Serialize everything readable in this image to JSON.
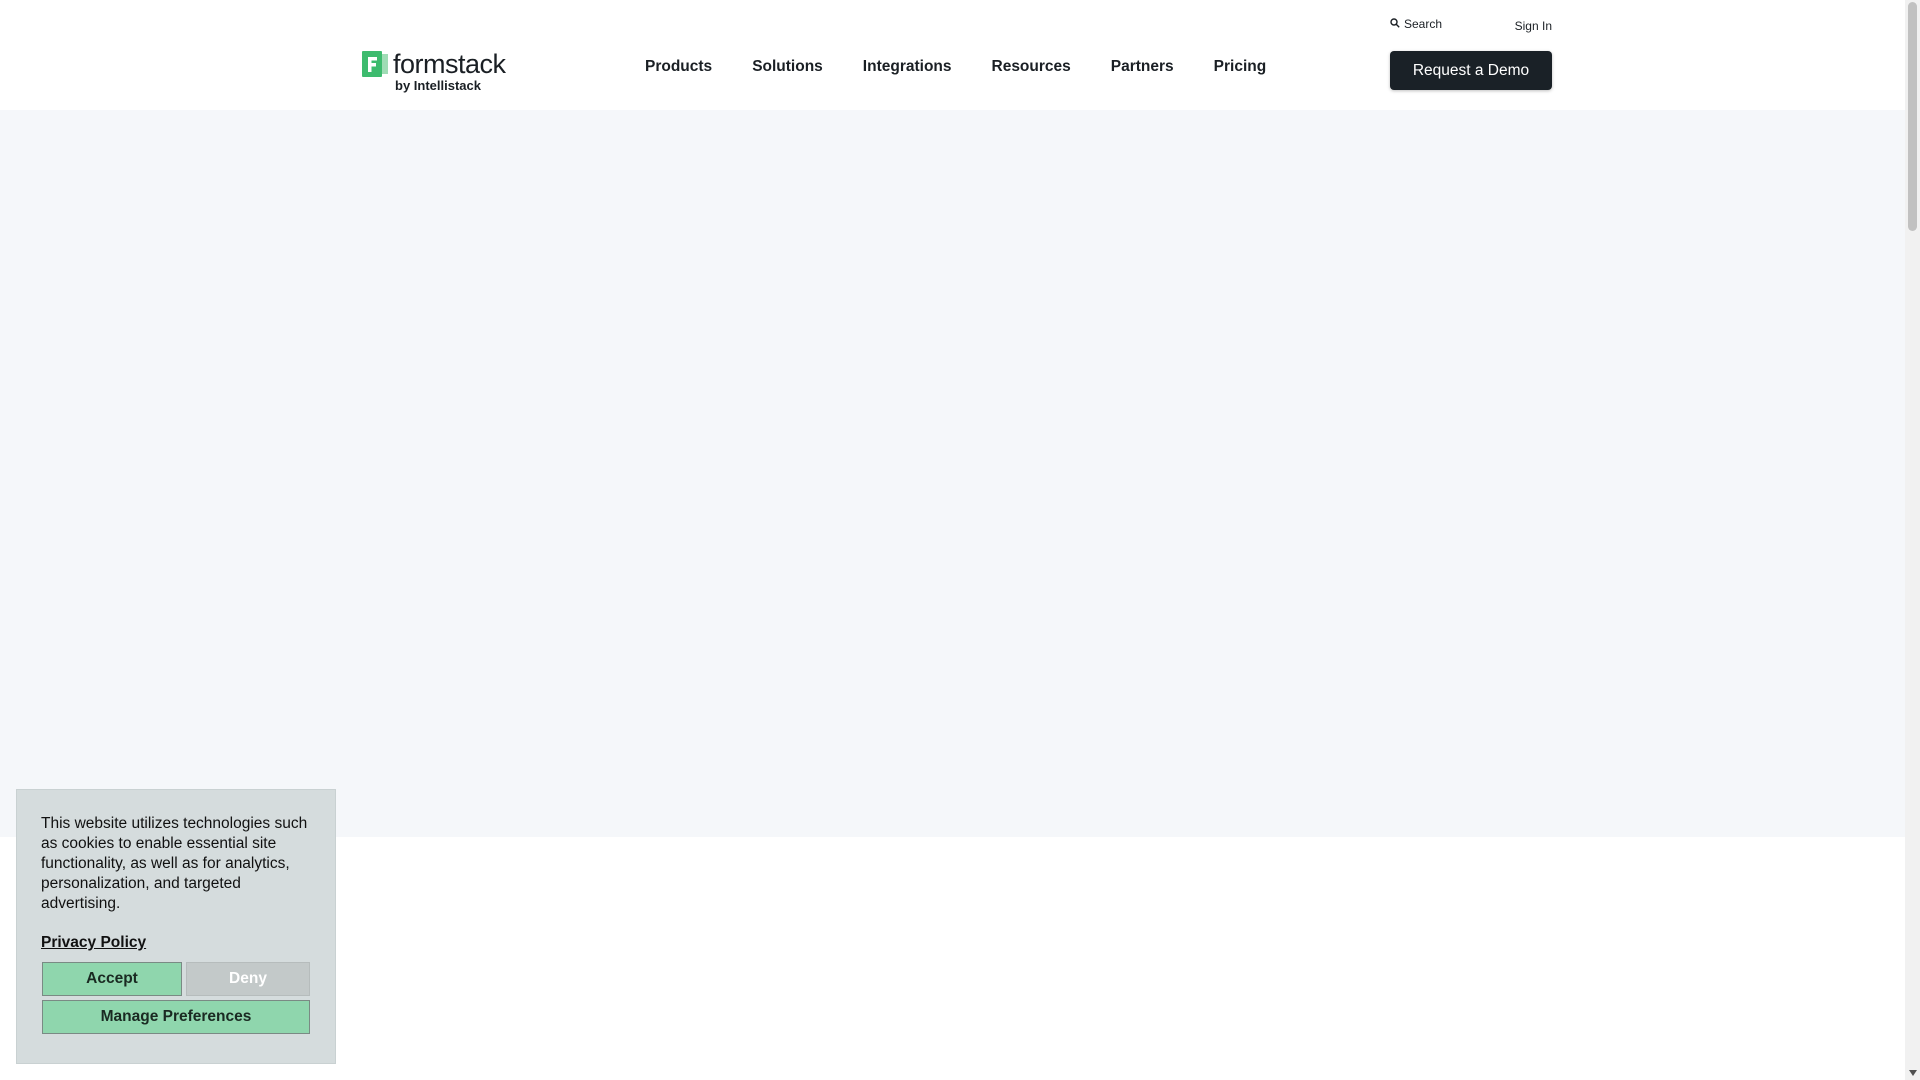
{
  "header": {
    "logo": {
      "wordmark": "formstack",
      "byline": "by Intellistack",
      "icon": "formstack-logo-icon"
    },
    "utility": {
      "search_label": "Search",
      "search_icon": "search-icon",
      "signin_label": "Sign In"
    },
    "nav": [
      {
        "label": "Products"
      },
      {
        "label": "Solutions"
      },
      {
        "label": "Integrations"
      },
      {
        "label": "Resources"
      },
      {
        "label": "Partners"
      },
      {
        "label": "Pricing"
      }
    ],
    "cta_label": "Request a Demo"
  },
  "cookie_banner": {
    "text": "This website utilizes technologies such as cookies to enable essential site functionality, as well as for analytics, personalization, and targeted advertising.",
    "privacy_label": "Privacy Policy",
    "accept_label": "Accept",
    "deny_label": "Deny",
    "manage_label": "Manage Preferences"
  },
  "colors": {
    "brand_green": "#3dbb6e",
    "cta_bg": "#1a2127",
    "hero_bg": "#f5f7fa",
    "cookie_bg": "#d5dcdd",
    "accept_bg": "#8fd6ad",
    "deny_bg": "#c3c9c9"
  }
}
